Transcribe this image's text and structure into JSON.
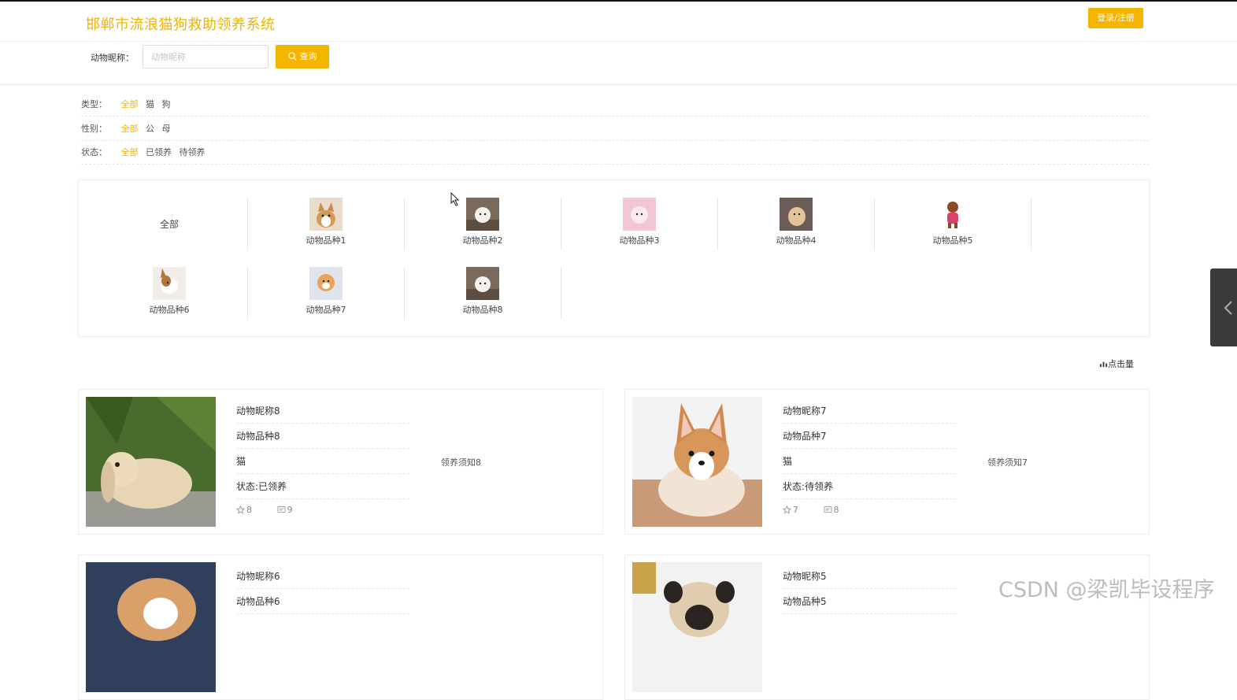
{
  "header": {
    "title": "邯郸市流浪猫狗救助领养系统",
    "login_label": "登录/注册"
  },
  "search": {
    "label": "动物昵称：",
    "placeholder": "动物昵称",
    "value": "",
    "button_label": "查询"
  },
  "filters": {
    "type": {
      "label": "类型：",
      "options": [
        "全部",
        "猫",
        "狗"
      ],
      "active": "全部"
    },
    "gender": {
      "label": "性别：",
      "options": [
        "全部",
        "公",
        "母"
      ],
      "active": "全部"
    },
    "status": {
      "label": "状态：",
      "options": [
        "全部",
        "已领养",
        "待领养"
      ],
      "active": "全部"
    }
  },
  "categories": {
    "all_label": "全部",
    "items": [
      {
        "name": "动物品种1",
        "icon": "corgi-thumb"
      },
      {
        "name": "动物品种2",
        "icon": "white-puppy-thumb"
      },
      {
        "name": "动物品种3",
        "icon": "pink-puppy-thumb"
      },
      {
        "name": "动物品种4",
        "icon": "tan-puppy-thumb"
      },
      {
        "name": "动物品种5",
        "icon": "poodle-thumb"
      },
      {
        "name": "动物品种6",
        "icon": "chihuahua-thumb"
      },
      {
        "name": "动物品种7",
        "icon": "pomeranian-thumb"
      },
      {
        "name": "动物品种8",
        "icon": "white-puppy-thumb"
      }
    ]
  },
  "sort": {
    "label": "点击量",
    "icon": "chart-icon"
  },
  "cards": [
    {
      "nickname": "动物昵称8",
      "breed": "动物品种8",
      "type": "猫",
      "status": "状态:已领养",
      "notice": "领养须知8",
      "favorites": "8",
      "comments": "9",
      "photo": "rabbit-photo"
    },
    {
      "nickname": "动物昵称7",
      "breed": "动物品种7",
      "type": "猫",
      "status": "状态:待领养",
      "notice": "领养须知7",
      "favorites": "7",
      "comments": "8",
      "photo": "corgi-photo"
    },
    {
      "nickname": "动物昵称6",
      "breed": "动物品种6",
      "photo": "puppy-photo"
    },
    {
      "nickname": "动物昵称5",
      "breed": "动物品种5",
      "photo": "pug-photo"
    }
  ],
  "watermark": "CSDN @梁凯毕设程序",
  "colors": {
    "accent": "#f5b400",
    "side_tab": "#3a3a3a"
  }
}
